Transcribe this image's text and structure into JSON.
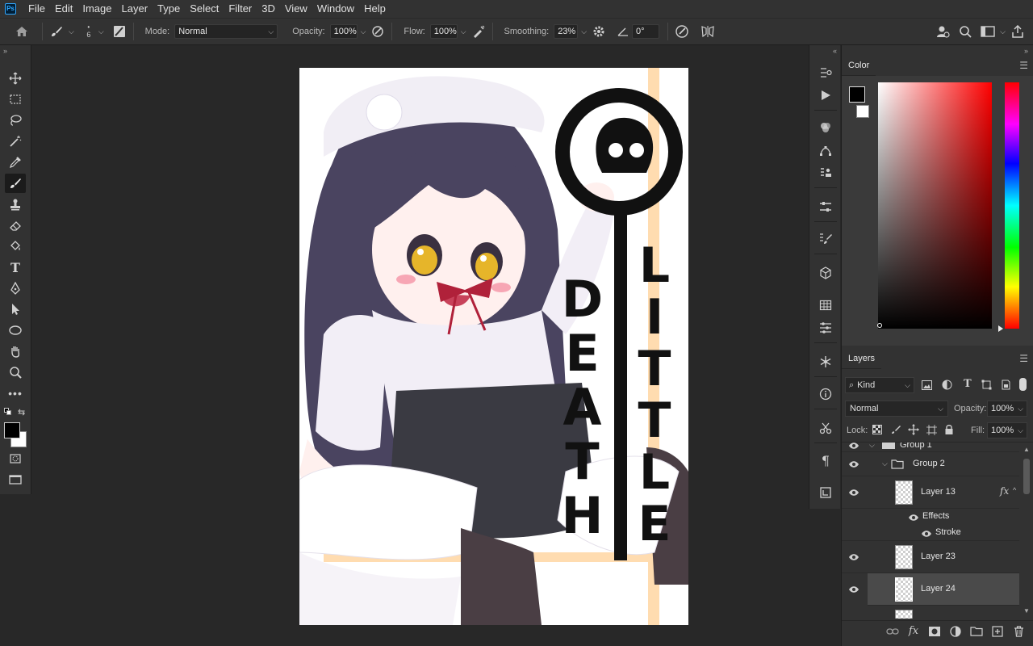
{
  "menubar": {
    "logo": "Ps",
    "items": [
      "File",
      "Edit",
      "Image",
      "Layer",
      "Type",
      "Select",
      "Filter",
      "3D",
      "View",
      "Window",
      "Help"
    ]
  },
  "options": {
    "brush_size": "6",
    "mode_label": "Mode:",
    "mode_value": "Normal",
    "opacity_label": "Opacity:",
    "opacity_value": "100%",
    "flow_label": "Flow:",
    "flow_value": "100%",
    "smoothing_label": "Smoothing:",
    "smoothing_value": "23%",
    "angle_value": "0°"
  },
  "artwork": {
    "title_left": "DEATH",
    "title_right": "LITTLE",
    "colors": {
      "hair": "#4a4460",
      "shirt": "#f2eef6",
      "skirt": "#3a3a42",
      "ribbon": "#b0213a",
      "stripe": "#ffdcb0"
    }
  },
  "color_panel": {
    "title": "Color",
    "foreground": "#000000",
    "background": "#ffffff",
    "hue": "#ff0000"
  },
  "layers_panel": {
    "title": "Layers",
    "filter_kind": "Kind",
    "blend_mode": "Normal",
    "opacity_label": "Opacity:",
    "opacity_value": "100%",
    "lock_label": "Lock:",
    "fill_label": "Fill:",
    "fill_value": "100%",
    "group1": "Group 1",
    "group2": "Group 2",
    "layer13": "Layer 13",
    "effects": "Effects",
    "stroke": "Stroke",
    "layer23": "Layer 23",
    "layer24": "Layer 24"
  }
}
